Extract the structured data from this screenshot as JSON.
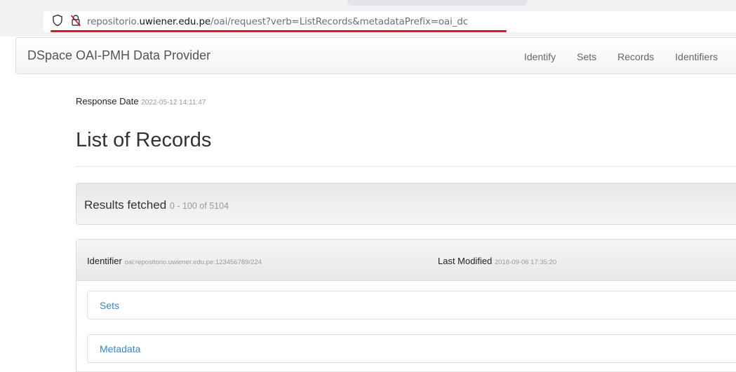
{
  "browser": {
    "url_prefix": "repositorio.",
    "url_host": "uwiener.edu.pe",
    "url_path": "/oai/request?verb=ListRecords&metadataPrefix=oai_dc",
    "icons": [
      "shield-icon",
      "insecure-lock-icon"
    ],
    "annotation_color": "#d71920"
  },
  "navbar": {
    "brand": "DSpace OAI-PMH Data Provider",
    "links": [
      "Identify",
      "Sets",
      "Records",
      "Identifiers"
    ]
  },
  "response": {
    "label": "Response Date",
    "value": "2022-05-12 14:11:47"
  },
  "page_title": "List of Records",
  "results": {
    "label": "Results fetched",
    "value": "0 - 100 of 5104"
  },
  "record": {
    "identifier_label": "Identifier",
    "identifier_value": "oai:repositorio.uwiener.edu.pe:123456789/224",
    "modified_label": "Last Modified",
    "modified_value": "2018-09-06 17:35:20",
    "sets_label": "Sets",
    "metadata_label": "Metadata"
  },
  "colors": {
    "link": "#3a87c8",
    "panel_border": "#d6e9c6"
  }
}
